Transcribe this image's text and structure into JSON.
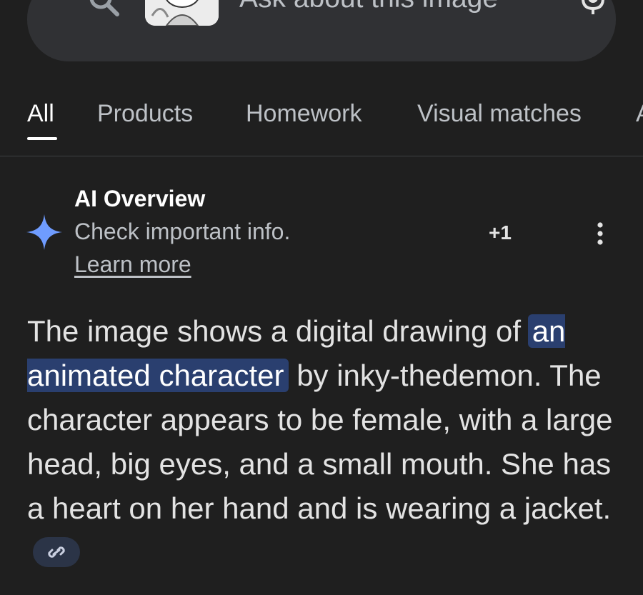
{
  "search": {
    "placeholder": "Ask about this image",
    "search_icon": "search-icon",
    "mic_icon": "mic-icon"
  },
  "tabs": [
    {
      "label": "All",
      "active": true
    },
    {
      "label": "Products",
      "active": false
    },
    {
      "label": "Homework",
      "active": false
    },
    {
      "label": "Visual matches",
      "active": false
    },
    {
      "label": "A",
      "active": false
    }
  ],
  "ai_overview": {
    "title": "AI Overview",
    "subtitle": "Check important info.",
    "learn_more": "Learn more",
    "count": "+1",
    "icon": "sparkle-icon",
    "menu_icon": "more-vert-icon"
  },
  "answer": {
    "before": "The image shows a digital drawing of ",
    "highlight": "an animated character",
    "after": " by inky-thedemon. The character appears to be female, with a large head, big eyes, and a small mouth. She has a heart on her hand and is wearing a jacket.",
    "link_icon": "link-icon"
  },
  "colors": {
    "background": "#1f1f1f",
    "highlight": "#2a3f6f",
    "sparkle": "#6f9cff"
  }
}
